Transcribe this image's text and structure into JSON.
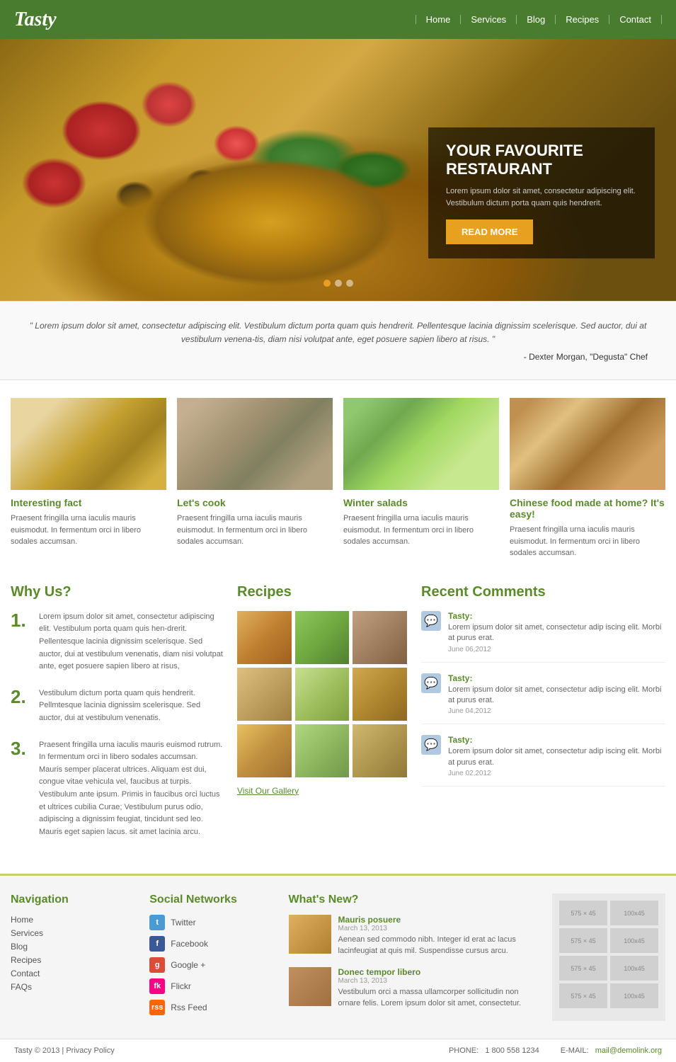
{
  "header": {
    "logo": "Tasty",
    "nav": [
      "Home",
      "Services",
      "Blog",
      "Recipes",
      "Contact"
    ]
  },
  "hero": {
    "title": "YOUR FAVOURITE RESTAURANT",
    "description": "Lorem ipsum dolor sit amet, consectetur adipiscing elit. Vestibulum dictum porta quam quis hendrerit.",
    "button_label": "READ MORE",
    "dots": [
      {
        "active": true
      },
      {
        "active": false
      },
      {
        "active": false
      }
    ]
  },
  "quote": {
    "text": "\" Lorem ipsum dolor sit amet, consectetur adipiscing elit. Vestibulum dictum porta quam quis hendrerit. Pellentesque lacinia dignissim scelerisque. Sed auctor, dui at vestibulum venena-tis, diam nisi volutpat ante, eget posuere sapien libero at risus. \"",
    "author": "- Dexter Morgan, \"Degusta\" Chef"
  },
  "cards": [
    {
      "img_class": "soup",
      "title": "Interesting fact",
      "text": "Praesent fringilla urna iaculis mauris euismodut. In fermentum orci in libero sodales accumsan."
    },
    {
      "img_class": "fish",
      "title": "Let's cook",
      "text": "Praesent fringilla urna iaculis mauris euismodut. In fermentum orci in libero sodales accumsan."
    },
    {
      "img_class": "salad",
      "title": "Winter salads",
      "text": "Praesent fringilla urna iaculis mauris euismodut. In fermentum orci in libero sodales accumsan."
    },
    {
      "img_class": "noodles",
      "title": "Chinese food made at home? It's easy!",
      "text": "Praesent fringilla urna iaculis mauris euismodut. In fermentum orci in libero sodales accumsan."
    }
  ],
  "why_us": {
    "title": "Why Us?",
    "items": [
      {
        "num": "1.",
        "text": "Lorem ipsum dolor sit amet, consectetur adipiscing elit. Vestibulum porta quam quis hen-drerit. Pellentesque lacinia dignissim scelerisque. Sed auctor, dui at vestibulum venenatis, diam nisi volutpat ante, eget posuere sapien libero at risus,"
      },
      {
        "num": "2.",
        "text": "Vestibulum dictum porta quam quis hendrerit. Pellmtesque lacinia dignissim scelerisque. Sed auctor, dui at vestibulum venenatis."
      },
      {
        "num": "3.",
        "text": "Praesent fringilla urna iaculis mauris euismod rutrum. In fermentum orci in libero sodales accumsan. Mauris semper placerat ultrices. Aliquam est dui, congue vitae vehicula vel, faucibus at turpis. Vestibulum ante ipsum. Primis in faucibus orci luctus et ultrices cubilia Curae; Vestibulum purus odio, adipiscing a dignissim feugiat, tincidunt sed leo. Mauris eget sapien lacus. sit amet lacinia arcu."
      }
    ]
  },
  "recipes": {
    "title": "Recipes",
    "thumbs": [
      "r1",
      "r2",
      "r3",
      "r4",
      "r5",
      "r6",
      "r7",
      "r8",
      "r9"
    ],
    "gallery_link": "Visit Our Gallery"
  },
  "recent_comments": {
    "title": "Recent Comments",
    "items": [
      {
        "name": "Tasty:",
        "text": "Lorem ipsum dolor sit amet, consectetur adip iscing elit. Morbi at purus erat.",
        "date": "June 06,2012"
      },
      {
        "name": "Tasty:",
        "text": "Lorem ipsum dolor sit amet, consectetur adip iscing elit. Morbi at purus erat.",
        "date": "June 04,2012"
      },
      {
        "name": "Tasty:",
        "text": "Lorem ipsum dolor sit amet, consectetur adip iscing elit. Morbi at purus erat.",
        "date": "June 02,2012"
      }
    ]
  },
  "footer_nav": {
    "title": "Navigation",
    "links": [
      "Home",
      "Services",
      "Blog",
      "Recipes",
      "Contact",
      "FAQs"
    ]
  },
  "footer_social": {
    "title": "Social Networks",
    "items": [
      {
        "icon": "si-twitter",
        "label": "Twitter",
        "letter": "t"
      },
      {
        "icon": "si-facebook",
        "label": "Facebook",
        "letter": "f"
      },
      {
        "icon": "si-google",
        "label": "Google +",
        "letter": "g"
      },
      {
        "icon": "si-flickr",
        "label": "Flickr",
        "letter": "fk"
      },
      {
        "icon": "si-rss",
        "label": "Rss Feed",
        "letter": "rss"
      }
    ]
  },
  "footer_news": {
    "title": "What's New?",
    "items": [
      {
        "thumb_class": "n1",
        "title": "Mauris posuere",
        "date": "March 13, 2013",
        "text": "Aenean sed commodo nibh. Integer id erat ac lacus lacinfeugiat at quis mil. Suspendisse cursus arcu."
      },
      {
        "thumb_class": "n2",
        "title": "Donec tempor libero",
        "date": "March 13, 2013",
        "text": "Vestibulum orci a massa ullamcorper sollicitudin non ornare felis. Lorem ipsum dolor sit amet, consectetur."
      }
    ]
  },
  "footer_bottom": {
    "copyright": "Tasty © 2013 | Privacy Policy",
    "phone_label": "PHONE:",
    "phone": "1 800 558 1234",
    "email_label": "E-MAIL:",
    "email": "mail@demolink.org"
  }
}
